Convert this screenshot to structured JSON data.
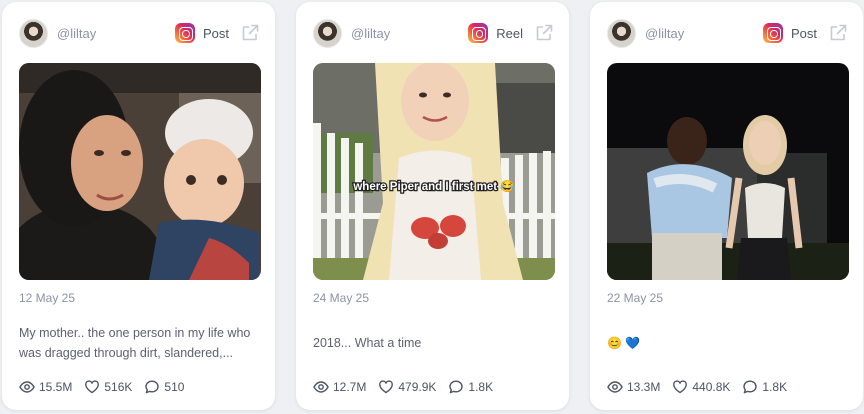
{
  "cards": [
    {
      "handle": "@liltay",
      "type": "Post",
      "date": "12 May 25",
      "caption": "My mother.. the one person in my life who was dragged through dirt, slandered,...",
      "stats": {
        "views": "15.5M",
        "likes": "516K",
        "comments": "510"
      }
    },
    {
      "handle": "@liltay",
      "type": "Reel",
      "overlay": "where Piper and I first met 😂",
      "date": "24 May 25",
      "caption": "2018... What a time",
      "stats": {
        "views": "12.7M",
        "likes": "479.9K",
        "comments": "1.8K"
      }
    },
    {
      "handle": "@liltay",
      "type": "Post",
      "date": "22 May 25",
      "caption": "😊 💙",
      "stats": {
        "views": "13.3M",
        "likes": "440.8K",
        "comments": "1.8K"
      }
    }
  ],
  "icons": {
    "platform": "instagram-icon",
    "external": "external-link-icon",
    "views": "eye-icon",
    "likes": "heart-icon",
    "comments": "comment-icon"
  },
  "colors": {
    "background": "#eef0f4",
    "card": "#ffffff",
    "muted_text": "#8a94a6",
    "body_text": "#4b5563"
  }
}
